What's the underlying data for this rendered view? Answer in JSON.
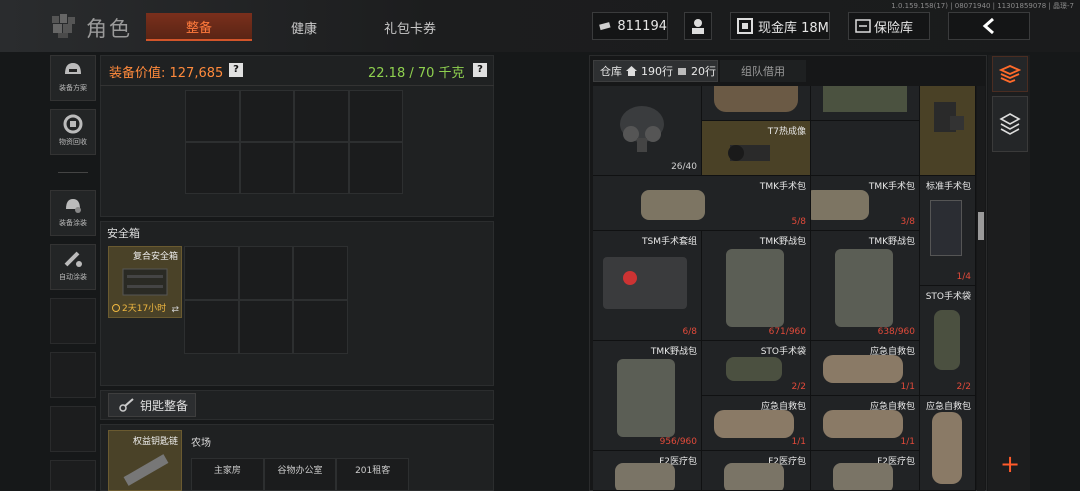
{
  "version": "1.0.159.158(17) | 08071940 | 11301859078 | 晶璟-7",
  "header": {
    "title": "角色",
    "tabs": [
      "整备",
      "健康",
      "礼包卡券"
    ],
    "active_tab": 0
  },
  "currency": {
    "money": "811194",
    "vault_label": "现金库 18M",
    "insurance_label": "保险库"
  },
  "sidebar": [
    {
      "label": "装备方案",
      "icon": "helmet-icon"
    },
    {
      "label": "物资回收",
      "icon": "recycle-icon"
    },
    {
      "label": "装备涂装",
      "icon": "paint-icon"
    },
    {
      "label": "自动涂装",
      "icon": "auto-paint-icon"
    }
  ],
  "equipment": {
    "value_label": "装备价值: 127,685",
    "weight_label": "22.18 / 70 千克",
    "help": "?"
  },
  "safebox": {
    "title": "安全箱",
    "item_name": "复合安全箱",
    "timer": "2天17小时"
  },
  "key_section": {
    "label": "钥匙整备",
    "item_name": "权益钥匙链",
    "area": "农场",
    "keys": [
      "主家房",
      "谷物办公室",
      "201租客"
    ]
  },
  "warehouse": {
    "tab_label": "仓库",
    "rows1": "190行",
    "rows2": "20行",
    "team_tab": "组队借用"
  },
  "items": [
    {
      "name": "",
      "count": "26/40"
    },
    {
      "name": "T7热成像",
      "count": ""
    },
    {
      "name": "TMK手术包",
      "count": "5/8"
    },
    {
      "name": "TMK手术包",
      "count": "3/8"
    },
    {
      "name": "标准手术包",
      "count": "1/4"
    },
    {
      "name": "TSM手术套组",
      "count": "6/8"
    },
    {
      "name": "TMK野战包",
      "count": "671/960"
    },
    {
      "name": "TMK野战包",
      "count": "638/960"
    },
    {
      "name": "STO手术袋",
      "count": "2/2"
    },
    {
      "name": "TMK野战包",
      "count": "956/960"
    },
    {
      "name": "STO手术袋",
      "count": "2/2"
    },
    {
      "name": "应急自救包",
      "count": "1/1"
    },
    {
      "name": "应急自救包",
      "count": "1/1"
    },
    {
      "name": "应急自救包",
      "count": "1/1"
    },
    {
      "name": "应急自救包",
      "count": ""
    },
    {
      "name": "F2医疗包",
      "count": ""
    },
    {
      "name": "F2医疗包",
      "count": ""
    },
    {
      "name": "F2医疗包",
      "count": ""
    }
  ],
  "colors": {
    "accent": "#ff6a2a",
    "count_red": "#e24a3a",
    "weight_green": "#8fd14f",
    "value_orange": "#ff8a3c"
  }
}
